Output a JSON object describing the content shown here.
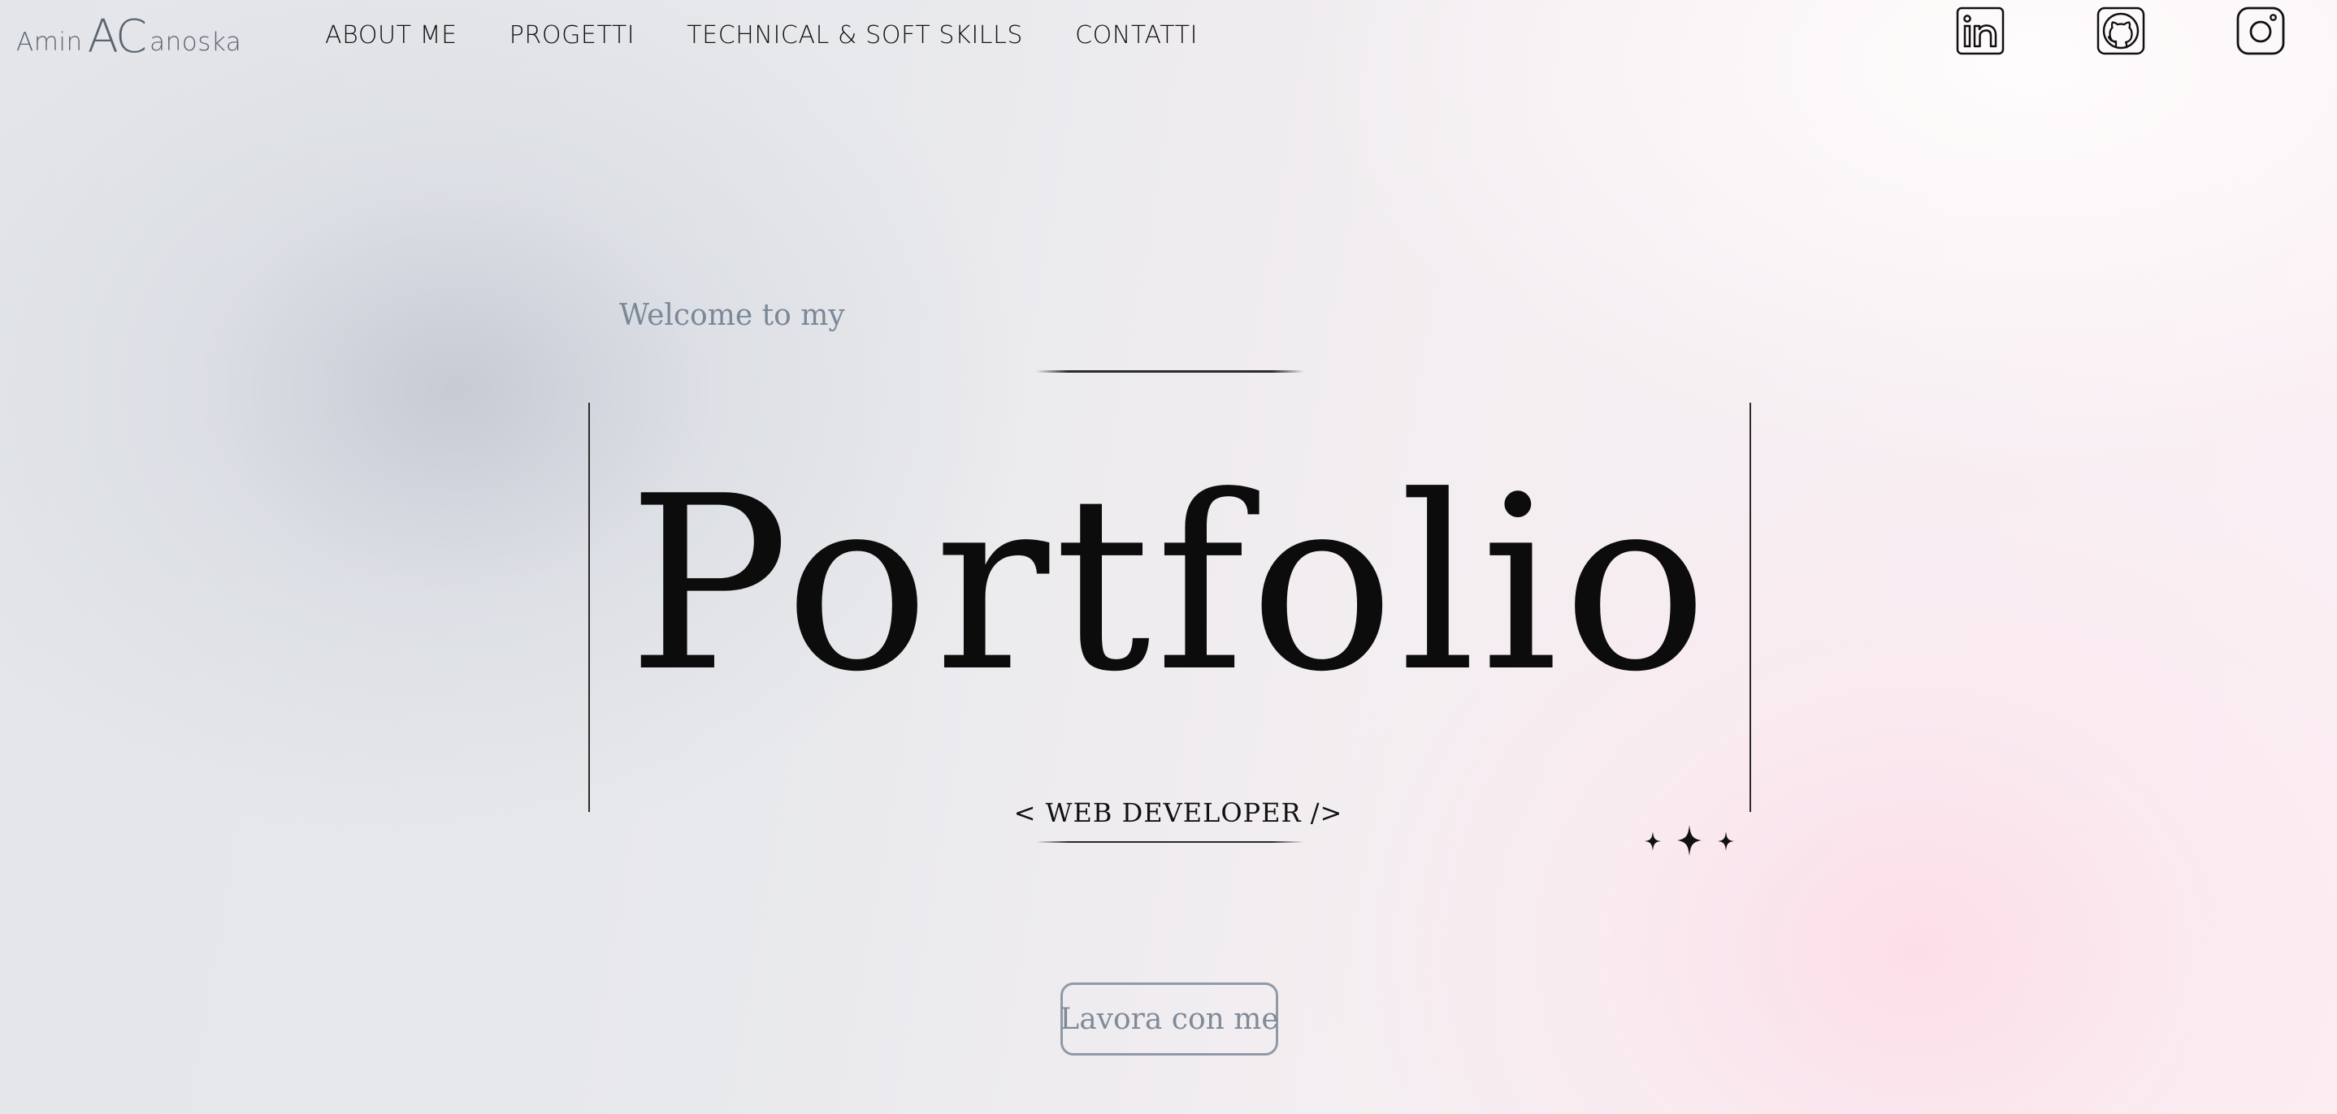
{
  "logo": {
    "first": "Amin",
    "initials": "AC",
    "last": "anoska"
  },
  "nav": {
    "items": [
      {
        "label": "ABOUT ME"
      },
      {
        "label": "PROGETTI"
      },
      {
        "label": "TECHNICAL & SOFT SKILLS"
      },
      {
        "label": "CONTATTI"
      }
    ]
  },
  "social": [
    {
      "icon": "linkedin-icon"
    },
    {
      "icon": "github-icon"
    },
    {
      "icon": "instagram-icon"
    }
  ],
  "hero": {
    "welcome": "Welcome to my",
    "title": "Portfolio",
    "subtitle": "< WEB DEVELOPER />",
    "decoration": "sparkles-icon",
    "cta_label": "Lavora con me"
  },
  "colors": {
    "text": "#0c0c0c",
    "muted": "#7b8898",
    "button_border": "#8e9aa8",
    "bg_grey": "#e3e5e9",
    "bg_pink": "#fbeff4"
  }
}
